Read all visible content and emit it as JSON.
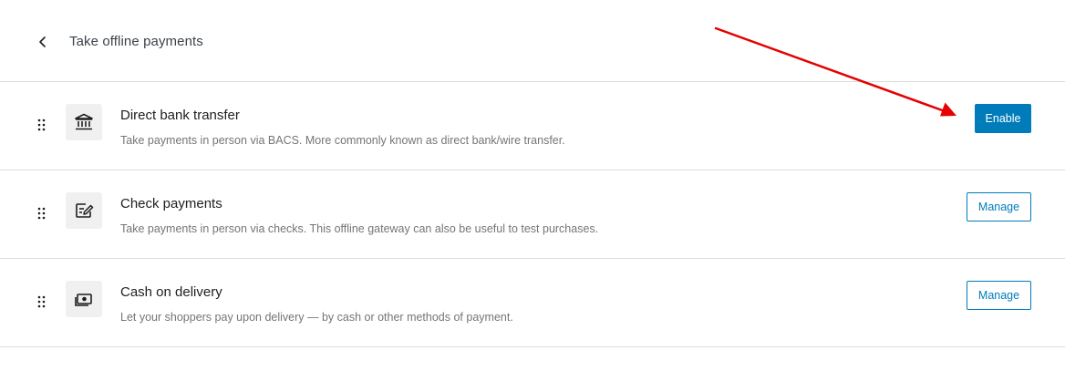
{
  "header": {
    "title": "Take offline payments"
  },
  "methods": [
    {
      "title": "Direct bank transfer",
      "description": "Take payments in person via BACS. More commonly known as direct bank/wire transfer.",
      "icon": "bank-icon",
      "action_label": "Enable"
    },
    {
      "title": "Check payments",
      "description": "Take payments in person via checks. This offline gateway can also be useful to test purchases.",
      "icon": "check-icon",
      "action_label": "Manage"
    },
    {
      "title": "Cash on delivery",
      "description": "Let your shoppers pay upon delivery — by cash or other methods of payment.",
      "icon": "cash-icon",
      "action_label": "Manage"
    }
  ],
  "colors": {
    "accent": "#007cba",
    "annotation_arrow": "#e60000",
    "divider": "#dcdcde",
    "icon_bg": "#f0f0f0"
  }
}
